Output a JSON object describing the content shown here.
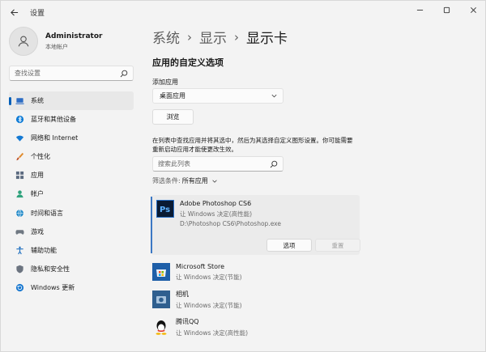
{
  "window": {
    "title": "设置",
    "controls": [
      "minimize-icon",
      "maximize-icon",
      "close-icon"
    ]
  },
  "profile": {
    "name": "Administrator",
    "account": "本地帐户"
  },
  "sidebar": {
    "search_placeholder": "查找设置",
    "items": [
      {
        "label": "系统",
        "icon": "laptop-icon",
        "active": true
      },
      {
        "label": "蓝牙和其他设备",
        "icon": "bluetooth-icon",
        "active": false
      },
      {
        "label": "网络和 Internet",
        "icon": "wifi-icon",
        "active": false
      },
      {
        "label": "个性化",
        "icon": "brush-icon",
        "active": false
      },
      {
        "label": "应用",
        "icon": "apps-icon",
        "active": false
      },
      {
        "label": "帐户",
        "icon": "person-icon",
        "active": false
      },
      {
        "label": "时间和语言",
        "icon": "globe-clock-icon",
        "active": false
      },
      {
        "label": "游戏",
        "icon": "gamepad-icon",
        "active": false
      },
      {
        "label": "辅助功能",
        "icon": "accessibility-icon",
        "active": false
      },
      {
        "label": "隐私和安全性",
        "icon": "shield-icon",
        "active": false
      },
      {
        "label": "Windows 更新",
        "icon": "update-icon",
        "active": false
      }
    ]
  },
  "breadcrumb": {
    "items": [
      "系统",
      "显示"
    ],
    "separator": "›",
    "current": "显示卡"
  },
  "main": {
    "section_title": "应用的自定义选项",
    "add_app_label": "添加应用",
    "dropdown_value": "桌面应用",
    "browse_label": "浏览",
    "description": "在列表中查找应用并将其选中，然后为其选择自定义图形设置。你可能需要重新启动应用才能使更改生效。",
    "list_search_placeholder": "搜索此列表",
    "filter_label": "筛选条件:",
    "filter_value": "所有应用"
  },
  "apps": [
    {
      "name": "Adobe Photoshop CS6",
      "setting": "让 Windows 决定(高性能)",
      "path": "D:\\Photoshop CS6\\Photoshop.exe",
      "icon": "photoshop-icon",
      "expanded": true,
      "options_label": "选项",
      "reset_label": "重置"
    },
    {
      "name": "Microsoft Store",
      "setting": "让 Windows 决定(节能)",
      "icon": "store-icon"
    },
    {
      "name": "相机",
      "setting": "让 Windows 决定(节能)",
      "icon": "camera-icon"
    },
    {
      "name": "腾讯QQ",
      "setting": "让 Windows 决定(高性能)",
      "icon": "qq-icon"
    }
  ],
  "colors": {
    "accent": "#005fb8",
    "window_bg": "#f3f3f3",
    "selected_card": "#ebebeb"
  }
}
